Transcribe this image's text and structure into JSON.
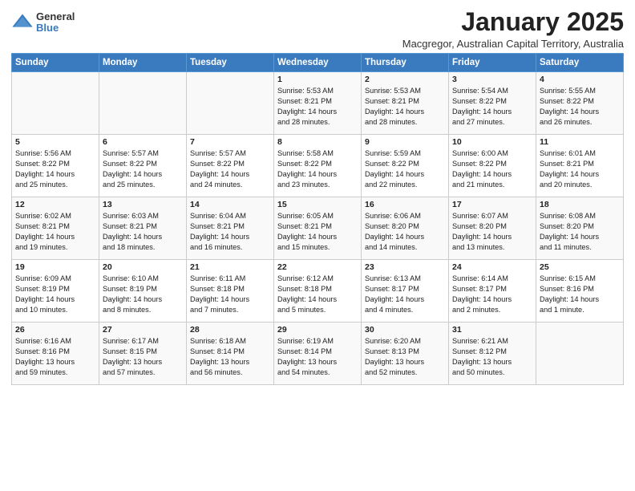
{
  "header": {
    "logo": {
      "general": "General",
      "blue": "Blue"
    },
    "title": "January 2025",
    "location": "Macgregor, Australian Capital Territory, Australia"
  },
  "days_of_week": [
    "Sunday",
    "Monday",
    "Tuesday",
    "Wednesday",
    "Thursday",
    "Friday",
    "Saturday"
  ],
  "weeks": [
    [
      {
        "day": "",
        "content": ""
      },
      {
        "day": "",
        "content": ""
      },
      {
        "day": "",
        "content": ""
      },
      {
        "day": "1",
        "content": "Sunrise: 5:53 AM\nSunset: 8:21 PM\nDaylight: 14 hours\nand 28 minutes."
      },
      {
        "day": "2",
        "content": "Sunrise: 5:53 AM\nSunset: 8:21 PM\nDaylight: 14 hours\nand 28 minutes."
      },
      {
        "day": "3",
        "content": "Sunrise: 5:54 AM\nSunset: 8:22 PM\nDaylight: 14 hours\nand 27 minutes."
      },
      {
        "day": "4",
        "content": "Sunrise: 5:55 AM\nSunset: 8:22 PM\nDaylight: 14 hours\nand 26 minutes."
      }
    ],
    [
      {
        "day": "5",
        "content": "Sunrise: 5:56 AM\nSunset: 8:22 PM\nDaylight: 14 hours\nand 25 minutes."
      },
      {
        "day": "6",
        "content": "Sunrise: 5:57 AM\nSunset: 8:22 PM\nDaylight: 14 hours\nand 25 minutes."
      },
      {
        "day": "7",
        "content": "Sunrise: 5:57 AM\nSunset: 8:22 PM\nDaylight: 14 hours\nand 24 minutes."
      },
      {
        "day": "8",
        "content": "Sunrise: 5:58 AM\nSunset: 8:22 PM\nDaylight: 14 hours\nand 23 minutes."
      },
      {
        "day": "9",
        "content": "Sunrise: 5:59 AM\nSunset: 8:22 PM\nDaylight: 14 hours\nand 22 minutes."
      },
      {
        "day": "10",
        "content": "Sunrise: 6:00 AM\nSunset: 8:22 PM\nDaylight: 14 hours\nand 21 minutes."
      },
      {
        "day": "11",
        "content": "Sunrise: 6:01 AM\nSunset: 8:21 PM\nDaylight: 14 hours\nand 20 minutes."
      }
    ],
    [
      {
        "day": "12",
        "content": "Sunrise: 6:02 AM\nSunset: 8:21 PM\nDaylight: 14 hours\nand 19 minutes."
      },
      {
        "day": "13",
        "content": "Sunrise: 6:03 AM\nSunset: 8:21 PM\nDaylight: 14 hours\nand 18 minutes."
      },
      {
        "day": "14",
        "content": "Sunrise: 6:04 AM\nSunset: 8:21 PM\nDaylight: 14 hours\nand 16 minutes."
      },
      {
        "day": "15",
        "content": "Sunrise: 6:05 AM\nSunset: 8:21 PM\nDaylight: 14 hours\nand 15 minutes."
      },
      {
        "day": "16",
        "content": "Sunrise: 6:06 AM\nSunset: 8:20 PM\nDaylight: 14 hours\nand 14 minutes."
      },
      {
        "day": "17",
        "content": "Sunrise: 6:07 AM\nSunset: 8:20 PM\nDaylight: 14 hours\nand 13 minutes."
      },
      {
        "day": "18",
        "content": "Sunrise: 6:08 AM\nSunset: 8:20 PM\nDaylight: 14 hours\nand 11 minutes."
      }
    ],
    [
      {
        "day": "19",
        "content": "Sunrise: 6:09 AM\nSunset: 8:19 PM\nDaylight: 14 hours\nand 10 minutes."
      },
      {
        "day": "20",
        "content": "Sunrise: 6:10 AM\nSunset: 8:19 PM\nDaylight: 14 hours\nand 8 minutes."
      },
      {
        "day": "21",
        "content": "Sunrise: 6:11 AM\nSunset: 8:18 PM\nDaylight: 14 hours\nand 7 minutes."
      },
      {
        "day": "22",
        "content": "Sunrise: 6:12 AM\nSunset: 8:18 PM\nDaylight: 14 hours\nand 5 minutes."
      },
      {
        "day": "23",
        "content": "Sunrise: 6:13 AM\nSunset: 8:17 PM\nDaylight: 14 hours\nand 4 minutes."
      },
      {
        "day": "24",
        "content": "Sunrise: 6:14 AM\nSunset: 8:17 PM\nDaylight: 14 hours\nand 2 minutes."
      },
      {
        "day": "25",
        "content": "Sunrise: 6:15 AM\nSunset: 8:16 PM\nDaylight: 14 hours\nand 1 minute."
      }
    ],
    [
      {
        "day": "26",
        "content": "Sunrise: 6:16 AM\nSunset: 8:16 PM\nDaylight: 13 hours\nand 59 minutes."
      },
      {
        "day": "27",
        "content": "Sunrise: 6:17 AM\nSunset: 8:15 PM\nDaylight: 13 hours\nand 57 minutes."
      },
      {
        "day": "28",
        "content": "Sunrise: 6:18 AM\nSunset: 8:14 PM\nDaylight: 13 hours\nand 56 minutes."
      },
      {
        "day": "29",
        "content": "Sunrise: 6:19 AM\nSunset: 8:14 PM\nDaylight: 13 hours\nand 54 minutes."
      },
      {
        "day": "30",
        "content": "Sunrise: 6:20 AM\nSunset: 8:13 PM\nDaylight: 13 hours\nand 52 minutes."
      },
      {
        "day": "31",
        "content": "Sunrise: 6:21 AM\nSunset: 8:12 PM\nDaylight: 13 hours\nand 50 minutes."
      },
      {
        "day": "",
        "content": ""
      }
    ]
  ]
}
